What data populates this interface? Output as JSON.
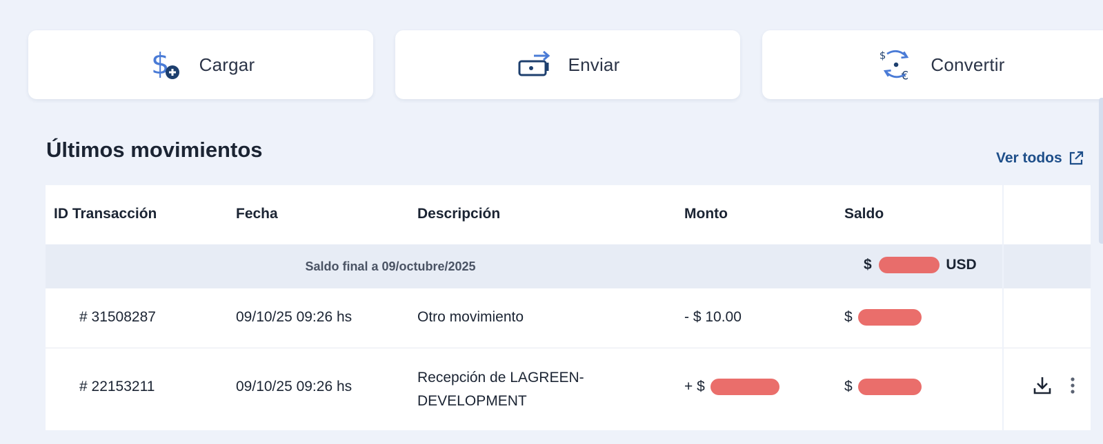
{
  "actions": [
    {
      "label": "Cargar",
      "icon": "dollar-plus-icon"
    },
    {
      "label": "Enviar",
      "icon": "send-card-icon"
    },
    {
      "label": "Convertir",
      "icon": "currency-convert-icon"
    }
  ],
  "section": {
    "title": "Últimos movimientos",
    "view_all": "Ver todos",
    "view_all_icon": "external-link-icon"
  },
  "table": {
    "headers": [
      "ID Transacción",
      "Fecha",
      "Descripción",
      "Monto",
      "Saldo"
    ],
    "summary": {
      "text": "Saldo final a 09/octubre/2025",
      "balance_prefix": "$",
      "balance_suffix": "USD"
    },
    "rows": [
      {
        "id": "# 31508287",
        "date": "09/10/25 09:26 hs",
        "description": "Otro movimiento",
        "amount": "- $ 10.00",
        "balance_prefix": "$"
      },
      {
        "id": "# 22153211",
        "date": "09/10/25 09:26 hs",
        "description": "Recepción de LAGREEN-DEVELOPMENT",
        "amount_prefix": "+ $",
        "balance_prefix": "$",
        "actions": [
          "download-icon",
          "more-vertical-icon"
        ]
      }
    ]
  },
  "colors": {
    "background": "#eef2fa",
    "card": "#ffffff",
    "accent": "#1d4e89",
    "icon_blue": "#4a7bd6",
    "redaction": "#e8625e"
  }
}
